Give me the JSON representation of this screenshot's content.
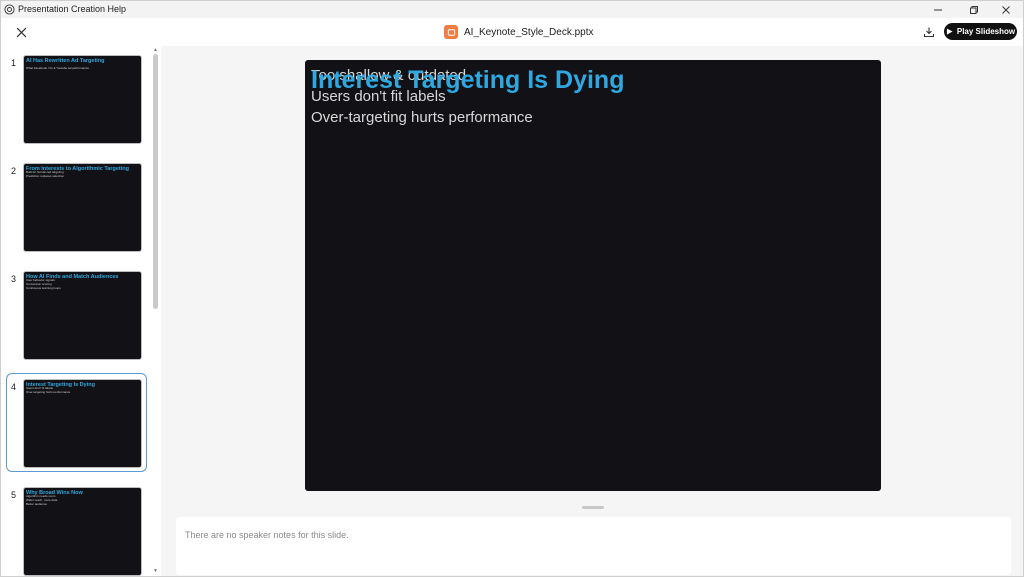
{
  "window": {
    "title": "Presentation Creation Help"
  },
  "header": {
    "file_name": "AI_Keynote_Style_Deck.pptx",
    "play_label": "Play Slideshow"
  },
  "slides": [
    {
      "number": "1",
      "title": "AI Has Rewritten Ad Targeting",
      "lines": [
        "What Facebook / IG & Youtube ad performance"
      ]
    },
    {
      "number": "2",
      "title": "From Interests to Algorithmic Targeting",
      "lines": [
        "Built for human-led targeting",
        "Prediction replaces selection"
      ]
    },
    {
      "number": "3",
      "title": "How AI Finds and Match Audiences",
      "lines": [
        "User behavior signals",
        "Conversion scoring",
        "Continuous learning loops"
      ]
    },
    {
      "number": "4",
      "title": "Interest Targeting Is Dying",
      "lines": [
        "Users don't fit labels",
        "Over-targeting hurts performance"
      ]
    },
    {
      "number": "5",
      "title": "Why Broad Wins Now",
      "lines": [
        "Algorithm needs room",
        "Wider reach, more data",
        "Better audience"
      ]
    }
  ],
  "current_slide": {
    "title": "Interest Targeting Is Dying",
    "bullets": [
      "Too shallow & outdated",
      "Users don't fit labels",
      "Over-targeting hurts performance"
    ]
  },
  "notes": {
    "text": "There are no speaker notes for this slide."
  },
  "colors": {
    "accent": "#2fa8e0",
    "slide_bg": "#121216",
    "selection": "#5b9bd5",
    "file_icon": "#f07d44"
  }
}
